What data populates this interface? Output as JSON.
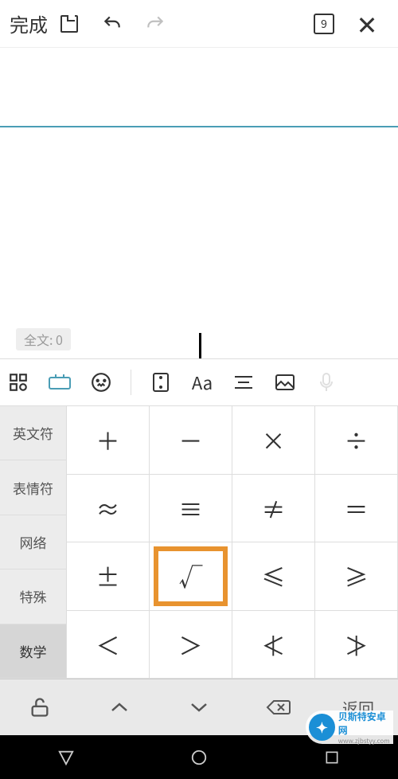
{
  "toolbar": {
    "done_label": "完成",
    "page_indicator": "9"
  },
  "content": {
    "text_count_label": "全文:",
    "text_count_value": "0"
  },
  "categories": [
    {
      "label": "英文符",
      "selected": false
    },
    {
      "label": "表情符",
      "selected": false
    },
    {
      "label": "网络",
      "selected": false
    },
    {
      "label": "特殊",
      "selected": false
    },
    {
      "label": "数学",
      "selected": true
    }
  ],
  "symbols": [
    [
      "＋",
      "－",
      "×",
      "÷"
    ],
    [
      "≈",
      "≡",
      "≠",
      "＝"
    ],
    [
      "±",
      "√",
      "≤",
      "≥"
    ],
    [
      "＜",
      "＞",
      "≮",
      "≯"
    ]
  ],
  "highlighted_symbol": {
    "row": 2,
    "col": 1
  },
  "bottom_bar": {
    "return_label": "返回"
  },
  "watermark": {
    "line1": "贝斯特安卓网",
    "line2": "www.zjbstyy.com"
  }
}
